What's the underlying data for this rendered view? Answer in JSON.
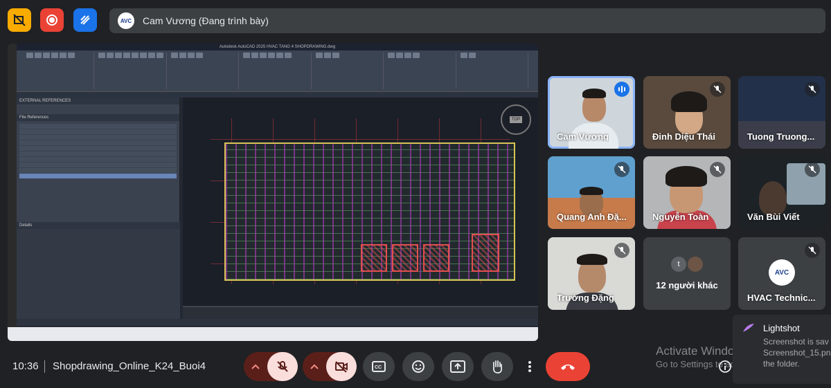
{
  "header": {
    "presenter_label": "Cam Vương (Đang trình bày)",
    "presenter_avatar_text": "AVC"
  },
  "shared_screen": {
    "app_title": "Autodesk AutoCAD 2025   HVAC TANG 4 SHOPDRAWING.dwg",
    "panel_title": "EXTERNAL REFERENCES",
    "file_references_header": "File References",
    "details_header": "Details"
  },
  "participants": [
    {
      "name": "Cam Vương",
      "speaking": true
    },
    {
      "name": "Đinh Diệu Thái",
      "muted": true
    },
    {
      "name": "Tuong Truong...",
      "muted": true
    },
    {
      "name": "Quang Anh Đặ...",
      "muted": true
    },
    {
      "name": "Nguyễn Toàn",
      "muted": true
    },
    {
      "name": "Văn Bùi Viết",
      "muted": true
    },
    {
      "name": "Trường Đặng",
      "muted": true
    },
    {
      "name": "12 người khác",
      "avatar_letter": "t"
    },
    {
      "name": "HVAC Technic...",
      "muted": true,
      "logo_text": "AVC"
    }
  ],
  "footer": {
    "time": "10:36",
    "meeting_name": "Shopdrawing_Online_K24_Buoi4"
  },
  "watermark": {
    "title": "Activate Windows",
    "subtitle": "Go to Settings to activate Windows."
  },
  "toast": {
    "title": "Lightshot",
    "line1": "Screenshot is sav",
    "line2": "Screenshot_15.pn",
    "line3": "the folder."
  },
  "colors": {
    "background": "#202124",
    "tile": "#3c4043",
    "end_call": "#ea4335",
    "active_speaker": "#8ab4f8"
  }
}
